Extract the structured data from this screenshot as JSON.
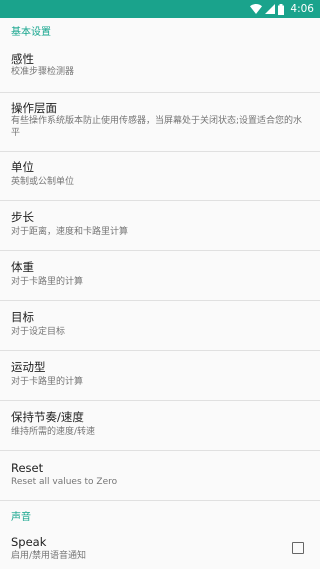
{
  "status_bar": {
    "time": "4:06",
    "color": "#1aa38c",
    "icons": [
      "wifi-icon",
      "signal-icon",
      "battery-icon"
    ]
  },
  "categories": {
    "basic": "基本设置",
    "sound": "声音"
  },
  "prefs": [
    {
      "title": "感性",
      "summary": "校准步骤检测器"
    },
    {
      "title": "操作层面",
      "summary": "有些操作系统版本防止使用传感器，当屏幕处于关闭状态;设置适合您的水平"
    },
    {
      "title": "单位",
      "summary": "英制或公制单位"
    },
    {
      "title": "步长",
      "summary": "对于距离，速度和卡路里计算"
    },
    {
      "title": "体重",
      "summary": "对于卡路里的计算"
    },
    {
      "title": "目标",
      "summary": "对于设定目标"
    },
    {
      "title": "运动型",
      "summary": "对于卡路里的计算"
    },
    {
      "title": "保持节奏/速度",
      "summary": "维持所需的速度/转速"
    },
    {
      "title": "Reset",
      "summary": "Reset all values to Zero"
    }
  ],
  "speak": {
    "title": "Speak",
    "summary": "启用/禁用语音通知",
    "checked": false
  },
  "colors": {
    "accent": "#15a58d",
    "title_text": "#212121",
    "summary_text": "#757575",
    "divider": "#e0e0e0",
    "background": "#fafafa"
  }
}
